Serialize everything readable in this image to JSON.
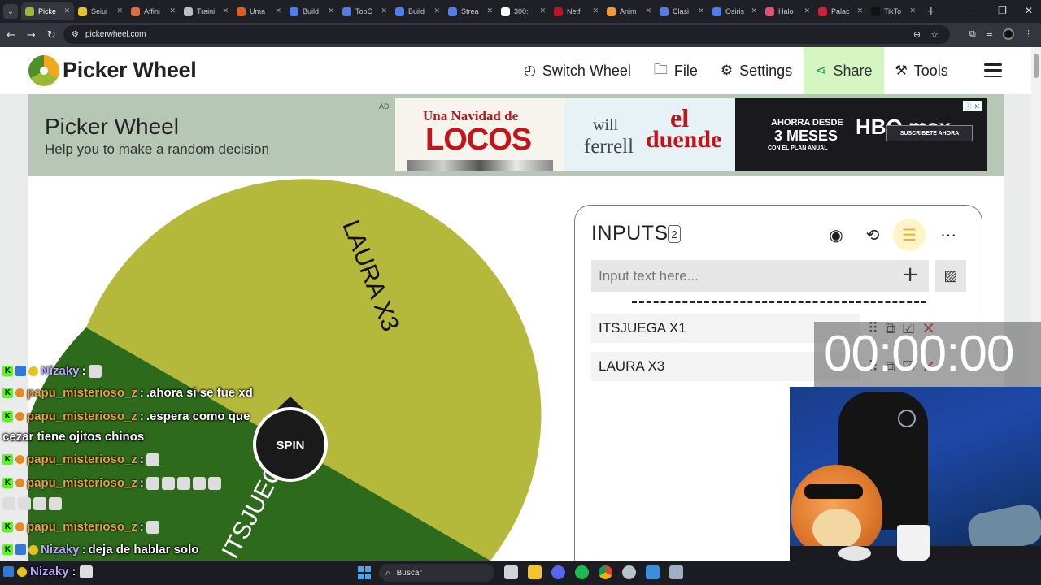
{
  "browser": {
    "tabs": [
      {
        "label": "Picke",
        "color": "#9aba35",
        "active": true
      },
      {
        "label": "Seiui",
        "color": "#e4c425"
      },
      {
        "label": "Affini",
        "color": "#e36a3a"
      },
      {
        "label": "Traini",
        "color": "#bdbdbd"
      },
      {
        "label": "Uma",
        "color": "#e05a1c"
      },
      {
        "label": "Build",
        "color": "#4f7df0"
      },
      {
        "label": "TopC",
        "color": "#4f7df0"
      },
      {
        "label": "Build",
        "color": "#4f7df0"
      },
      {
        "label": "Strea",
        "color": "#4f7df0"
      },
      {
        "label": "300:",
        "color": "#ffffff"
      },
      {
        "label": "Netfl",
        "color": "#c1121f"
      },
      {
        "label": "Anim",
        "color": "#f29a38"
      },
      {
        "label": "Clasi",
        "color": "#4f7df0"
      },
      {
        "label": "Osiris",
        "color": "#4f7df0"
      },
      {
        "label": "Halo",
        "color": "#e84a7a"
      },
      {
        "label": "Palac",
        "color": "#d11f3a"
      },
      {
        "label": "TikTo",
        "color": "#111111"
      }
    ],
    "url": "pickerwheel.com"
  },
  "site": {
    "brand": "Picker Wheel",
    "nav": [
      {
        "label": "Switch Wheel",
        "icon": "◴"
      },
      {
        "label": "File",
        "icon": "🗀"
      },
      {
        "label": "Settings",
        "icon": "⚙"
      },
      {
        "label": "Share",
        "icon": "⋖"
      },
      {
        "label": "Tools",
        "icon": "⚒"
      }
    ]
  },
  "banner": {
    "title": "Picker Wheel",
    "subtitle": "Help you to make a random decision"
  },
  "ad": {
    "label": "AD",
    "panel1_top": "Una Navidad de",
    "panel1_big": "LOCOS",
    "panel2_a": "will",
    "panel2_b": "el",
    "panel2_c": "ferrell",
    "panel2_d": "duende",
    "panel3_a": "AHORRA DESDE",
    "panel3_big": "3 MESES",
    "panel3_c": "CON EL PLAN ANUAL",
    "panel3_logo": "HBO max",
    "panel3_btn": "SUSCRÍBETE AHORA"
  },
  "wheel": {
    "spin_label": "SPIN",
    "segments": [
      {
        "label": "LAURA X3",
        "weight": 3,
        "color": "#b4b93c"
      },
      {
        "label": "ITSJUEGA X1",
        "weight": 1,
        "color": "#2d6a1c"
      }
    ]
  },
  "inputs": {
    "title": "INPUTS",
    "count": "2",
    "placeholder": "Input text here...",
    "entries": [
      "ITSJUEGA X1",
      "LAURA X3"
    ]
  },
  "timer": "00:00:00",
  "chat": [
    {
      "user": "Nizaky",
      "text": "",
      "purple": true
    },
    {
      "user": "papu_misterioso_z",
      "text": ".ahora si se fue xd"
    },
    {
      "user": "papu_misterioso_z",
      "text": ".espera como que"
    },
    {
      "user": "",
      "text": "cezar tiene ojitos chinos"
    },
    {
      "user": "papu_misterioso_z",
      "text": ""
    },
    {
      "user": "papu_misterioso_z",
      "text": ""
    },
    {
      "user": "papu_misterioso_z",
      "text": ""
    },
    {
      "user": "Nizaky",
      "text": "deja de hablar solo",
      "purple": true
    },
    {
      "user": "Nizaky",
      "text": "",
      "purple": true
    }
  ],
  "taskbar": {
    "search_label": "Buscar"
  }
}
